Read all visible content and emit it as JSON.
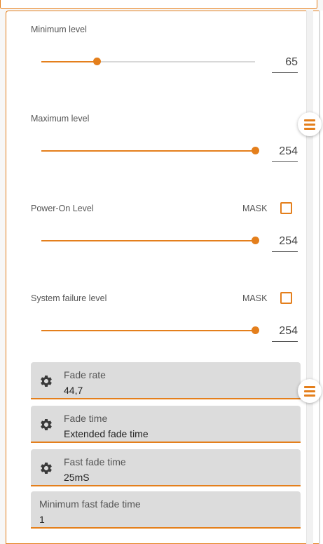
{
  "levels": {
    "minimum": {
      "label": "Minimum level",
      "value": "65",
      "fraction": 0.26
    },
    "maximum": {
      "label": "Maximum level",
      "value": "254",
      "fraction": 1.0
    },
    "power_on": {
      "label": "Power-On Level",
      "value": "254",
      "fraction": 1.0,
      "mask_label": "MASK",
      "mask_checked": false
    },
    "system_failure": {
      "label": "System failure level",
      "value": "254",
      "fraction": 1.0,
      "mask_label": "MASK",
      "mask_checked": false
    }
  },
  "fields": [
    {
      "label": "Fade rate",
      "value": "44,7",
      "icon": "gear-icon"
    },
    {
      "label": "Fade time",
      "value": "Extended fade time",
      "icon": "gear-icon"
    },
    {
      "label": "Fast fade time",
      "value": "25mS",
      "icon": "gear-icon"
    },
    {
      "label": "Minimum fast fade time",
      "value": "1"
    }
  ],
  "menu_buttons": [
    {
      "icon": "hamburger-menu-icon"
    },
    {
      "icon": "hamburger-menu-icon"
    }
  ],
  "colors": {
    "accent": "#e47f1c",
    "field_background": "#dcdcdc",
    "track": "#d8d8d8"
  }
}
